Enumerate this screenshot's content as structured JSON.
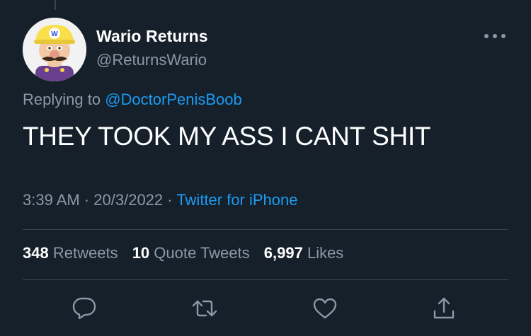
{
  "author": {
    "display_name": "Wario Returns",
    "handle": "@ReturnsWario",
    "avatar_logo_letter": "W"
  },
  "reply": {
    "prefix": "Replying to ",
    "mention": "@DoctorPenisBoob"
  },
  "tweet": {
    "text": "THEY TOOK MY ASS I CANT SHIT"
  },
  "meta": {
    "time": "3:39 AM",
    "separator1": " · ",
    "date": "20/3/2022",
    "separator2": " · ",
    "source": "Twitter for iPhone"
  },
  "stats": {
    "retweets_count": "348",
    "retweets_label": "Retweets",
    "quotes_count": "10",
    "quotes_label": "Quote Tweets",
    "likes_count": "6,997",
    "likes_label": "Likes"
  },
  "icons": {
    "more": "more-icon",
    "reply": "reply-icon",
    "retweet": "retweet-icon",
    "like": "heart-icon",
    "share": "share-icon"
  },
  "colors": {
    "background": "#15202b",
    "text_primary": "#ffffff",
    "text_secondary": "#8b98a5",
    "accent": "#1d9bf0",
    "divider": "#38444d"
  }
}
